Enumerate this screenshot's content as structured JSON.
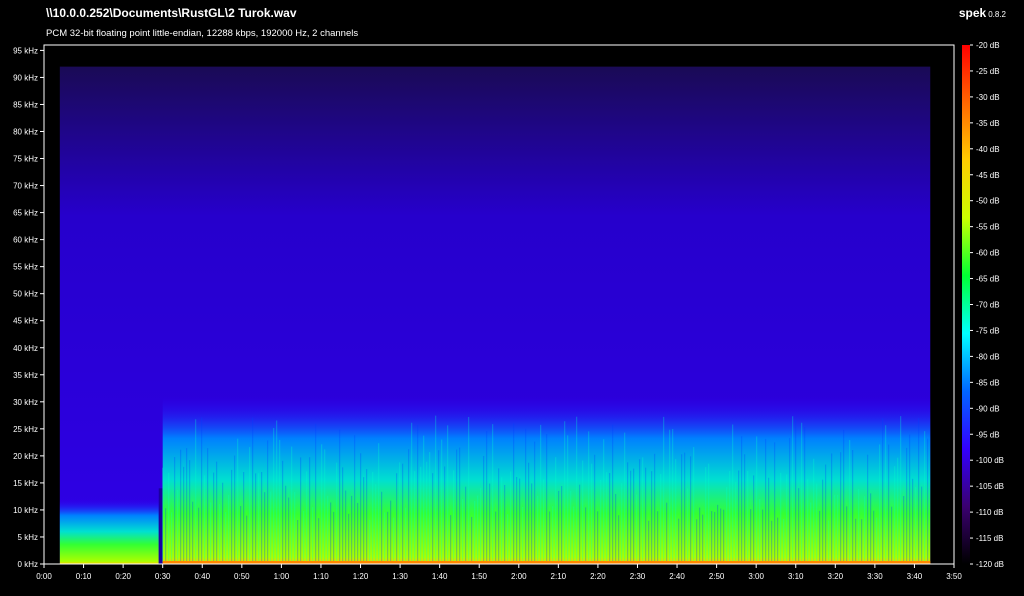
{
  "header": {
    "file_path": "\\\\10.0.0.252\\Documents\\RustGL\\2 Turok.wav",
    "file_info": "PCM 32-bit floating point little-endian, 12288 kbps, 192000 Hz, 2 channels",
    "app_name": "spek",
    "app_version": "0.8.2"
  },
  "chart_data": {
    "type": "heatmap",
    "title": "\\\\10.0.0.252\\Documents\\RustGL\\2 Turok.wav",
    "subtitle": "PCM 32-bit floating point little-endian, 12288 kbps, 192000 Hz, 2 channels",
    "x_axis": {
      "min_seconds": 0,
      "max_seconds": 230,
      "tick_seconds": [
        0,
        10,
        20,
        30,
        40,
        50,
        60,
        70,
        80,
        90,
        100,
        110,
        120,
        130,
        140,
        150,
        160,
        170,
        180,
        190,
        200,
        210,
        220,
        230
      ],
      "tick_labels": [
        "0:00",
        "0:10",
        "0:20",
        "0:30",
        "0:40",
        "0:50",
        "1:00",
        "1:10",
        "1:20",
        "1:30",
        "1:40",
        "1:50",
        "2:00",
        "2:10",
        "2:20",
        "2:30",
        "2:40",
        "2:50",
        "3:00",
        "3:10",
        "3:20",
        "3:30",
        "3:40",
        "3:50"
      ]
    },
    "y_axis": {
      "min_khz": 0,
      "max_khz": 96,
      "tick_khz": [
        0,
        5,
        10,
        15,
        20,
        25,
        30,
        35,
        40,
        45,
        50,
        55,
        60,
        65,
        70,
        75,
        80,
        85,
        90,
        95
      ],
      "tick_labels": [
        "0 kHz",
        "5 kHz",
        "10 kHz",
        "15 kHz",
        "20 kHz",
        "25 kHz",
        "30 kHz",
        "35 kHz",
        "40 kHz",
        "45 kHz",
        "50 kHz",
        "55 kHz",
        "60 kHz",
        "65 kHz",
        "70 kHz",
        "75 kHz",
        "80 kHz",
        "85 kHz",
        "90 kHz",
        "95 kHz"
      ]
    },
    "colorbar": {
      "min_db": -120,
      "max_db": -20,
      "tick_db": [
        -20,
        -25,
        -30,
        -35,
        -40,
        -45,
        -50,
        -55,
        -60,
        -65,
        -70,
        -75,
        -80,
        -85,
        -90,
        -95,
        -100,
        -105,
        -110,
        -115,
        -120
      ],
      "tick_labels": [
        "-20 dB",
        "-25 dB",
        "-30 dB",
        "-35 dB",
        "-40 dB",
        "-45 dB",
        "-50 dB",
        "-55 dB",
        "-60 dB",
        "-65 dB",
        "-70 dB",
        "-75 dB",
        "-80 dB",
        "-85 dB",
        "-90 dB",
        "-95 dB",
        "-100 dB",
        "-105 dB",
        "-110 dB",
        "-115 dB",
        "-120 dB"
      ],
      "colors": [
        "#000000",
        "#3a0070",
        "#3300ff",
        "#0066ff",
        "#00ffff",
        "#00ff33",
        "#ccff00",
        "#ffcc00",
        "#ff6600",
        "#ff0000"
      ]
    },
    "signal": {
      "audio_start_seconds": 4,
      "intro_end_seconds": 29,
      "main_start_seconds": 30,
      "audio_end_seconds": 224,
      "intro_bandwidth_khz": 12,
      "main_bandwidth_khz": 31,
      "noise_floor_top_khz": 92
    }
  }
}
